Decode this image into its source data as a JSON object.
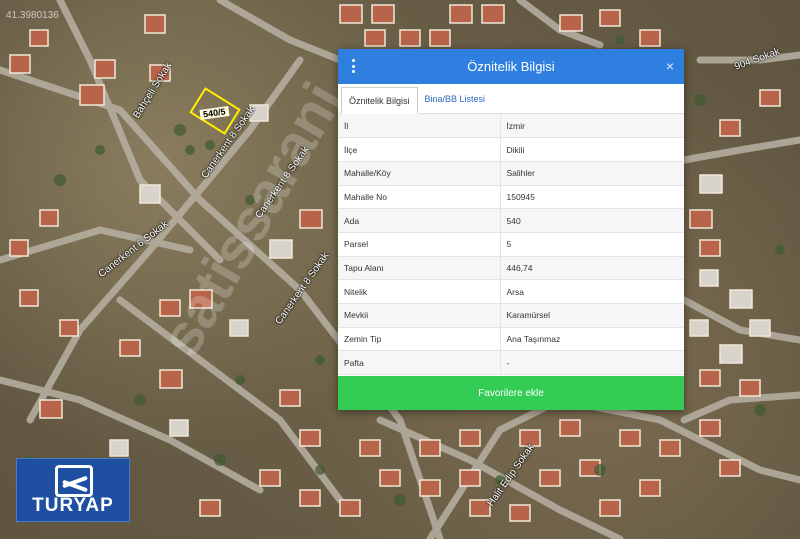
{
  "map": {
    "coordinate_text": "41.3980136",
    "parcel_label": "540/5",
    "street_labels": [
      "Bahçeli Sokak",
      "Canerkent 8 Sokak",
      "Canerkent 8 Sokak",
      "Canerkent 6 Sokak",
      "Canerkent 8 Sokak",
      "904 Sokak",
      "Halit Edip Sokak"
    ],
    "watermark": "satissarani"
  },
  "logo": {
    "text": "TURYAP"
  },
  "panel": {
    "title": "Öznitelik Bilgisi",
    "close": "×",
    "tabs": [
      {
        "label": "Öznitelik Bilgisi",
        "active": true
      },
      {
        "label": "Bina/BB Listesi",
        "active": false
      }
    ],
    "rows": [
      {
        "key": "İl",
        "value": "İzmir"
      },
      {
        "key": "İlçe",
        "value": "Dikili"
      },
      {
        "key": "Mahalle/Köy",
        "value": "Salihler"
      },
      {
        "key": "Mahalle No",
        "value": "150945"
      },
      {
        "key": "Ada",
        "value": "540"
      },
      {
        "key": "Parsel",
        "value": "5"
      },
      {
        "key": "Tapu Alanı",
        "value": "446,74"
      },
      {
        "key": "Nitelik",
        "value": "Arsa"
      },
      {
        "key": "Mevkii",
        "value": "Karamürsel"
      },
      {
        "key": "Zemin Tip",
        "value": "Ana Taşınmaz"
      },
      {
        "key": "Pafta",
        "value": "-"
      }
    ],
    "button_label": "Favorilere ekle"
  },
  "colors": {
    "header": "#2f7fe0",
    "button": "#33cc55",
    "parcel_outline": "#ffee00",
    "logo_bg": "#1f4fa0"
  }
}
